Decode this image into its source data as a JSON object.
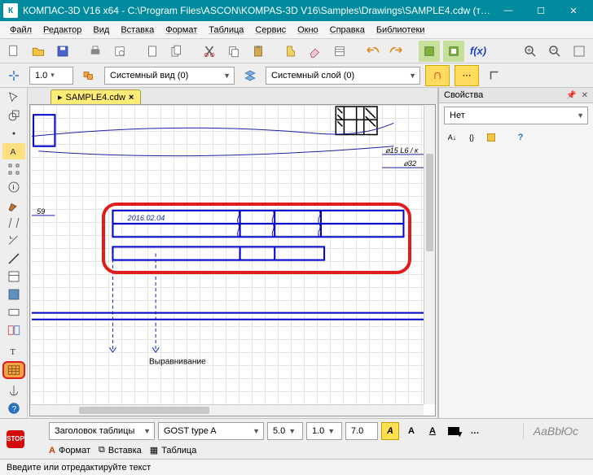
{
  "title": "КОМПАС-3D V16  x64 - C:\\Program Files\\ASCON\\KOMPAS-3D V16\\Samples\\Drawings\\SAMPLE4.cdw (то…",
  "menu": [
    "Файл",
    "Редактор",
    "Вид",
    "Вставка",
    "Формат",
    "Таблица",
    "Сервис",
    "Окно",
    "Справка",
    "Библиотеки"
  ],
  "toolbar2": {
    "spin": "1.0",
    "view_label": "Системный вид (0)",
    "layer_label": "Системный слой (0)"
  },
  "tab": {
    "label": "SAMPLE4.cdw"
  },
  "canvas": {
    "dim1": "⌀15 L6 / к",
    "dim2": "⌀32",
    "dim3": "59",
    "date": "2016.02.04",
    "align_label": "Выравнивание"
  },
  "props": {
    "title": "Свойства",
    "value": "Нет"
  },
  "bottom": {
    "dd1": "Заголовок таблицы",
    "dd2": "GOST type A",
    "sz1": "5.0",
    "sz2": "1.0",
    "sz3": "7.0",
    "preview": "AaBbłOc",
    "tab1": "Формат",
    "tab2": "Вставка",
    "tab3": "Таблица"
  },
  "status": "Введите или отредактируйте текст",
  "icons": {
    "fx": "f(x)"
  }
}
